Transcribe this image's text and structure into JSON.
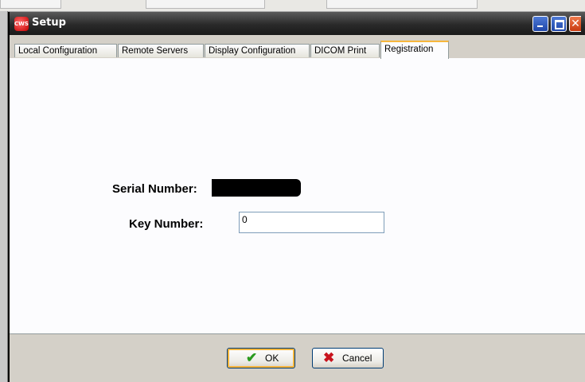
{
  "window": {
    "title": "Setup",
    "app_icon_text": "CWS"
  },
  "tabs": [
    {
      "label": "Local Configuration"
    },
    {
      "label": "Remote Servers"
    },
    {
      "label": "Display Configuration"
    },
    {
      "label": "DICOM Print"
    },
    {
      "label": "Registration"
    }
  ],
  "active_tab": "Registration",
  "registration": {
    "serial_label": "Serial Number:",
    "key_label": "Key Number:",
    "key_value": "0"
  },
  "footer": {
    "ok_label": "OK",
    "cancel_label": "Cancel"
  },
  "icons": {
    "ok": "checkmark-icon",
    "cancel": "x-icon"
  },
  "colors": {
    "titlebar": "#1a1a1a",
    "active_tab_accent": "#f7b73c",
    "ok_check": "#2a9a1e",
    "cancel_x": "#c8141e"
  }
}
